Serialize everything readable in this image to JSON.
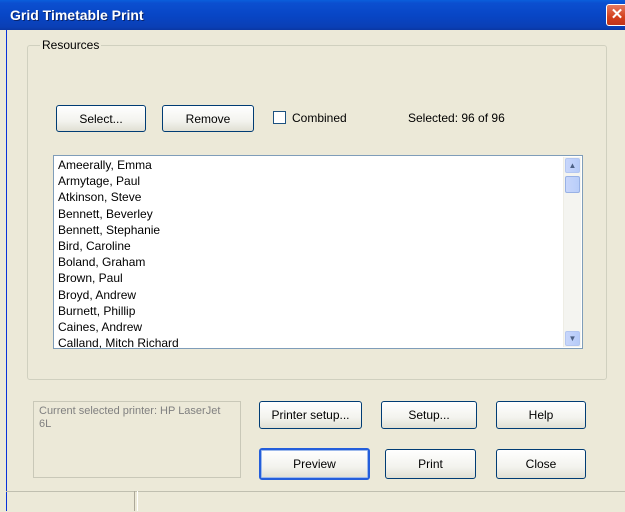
{
  "window": {
    "title": "Grid Timetable Print",
    "close_glyph": "✕"
  },
  "resources": {
    "group_label": "Resources",
    "select_button": "Select...",
    "remove_button": "Remove",
    "combined_label": "Combined",
    "combined_checked": false,
    "selected_status": "Selected: 96 of 96",
    "items": [
      "Ameerally, Emma",
      "Armytage, Paul",
      "Atkinson, Steve",
      "Bennett, Beverley",
      "Bennett, Stephanie",
      "Bird, Caroline",
      "Boland, Graham",
      "Brown, Paul",
      "Broyd, Andrew",
      "Burnett, Phillip",
      "Caines, Andrew",
      "Calland, Mitch Richard"
    ]
  },
  "printer": {
    "current_text": "Current selected printer: HP LaserJet 6L"
  },
  "buttons": {
    "printer_setup": "Printer setup...",
    "setup": "Setup...",
    "help": "Help",
    "preview": "Preview",
    "print": "Print",
    "close": "Close"
  },
  "icons": {
    "scroll_up": "scroll-up-arrow-icon",
    "scroll_down": "scroll-down-arrow-icon",
    "close": "close-icon"
  }
}
